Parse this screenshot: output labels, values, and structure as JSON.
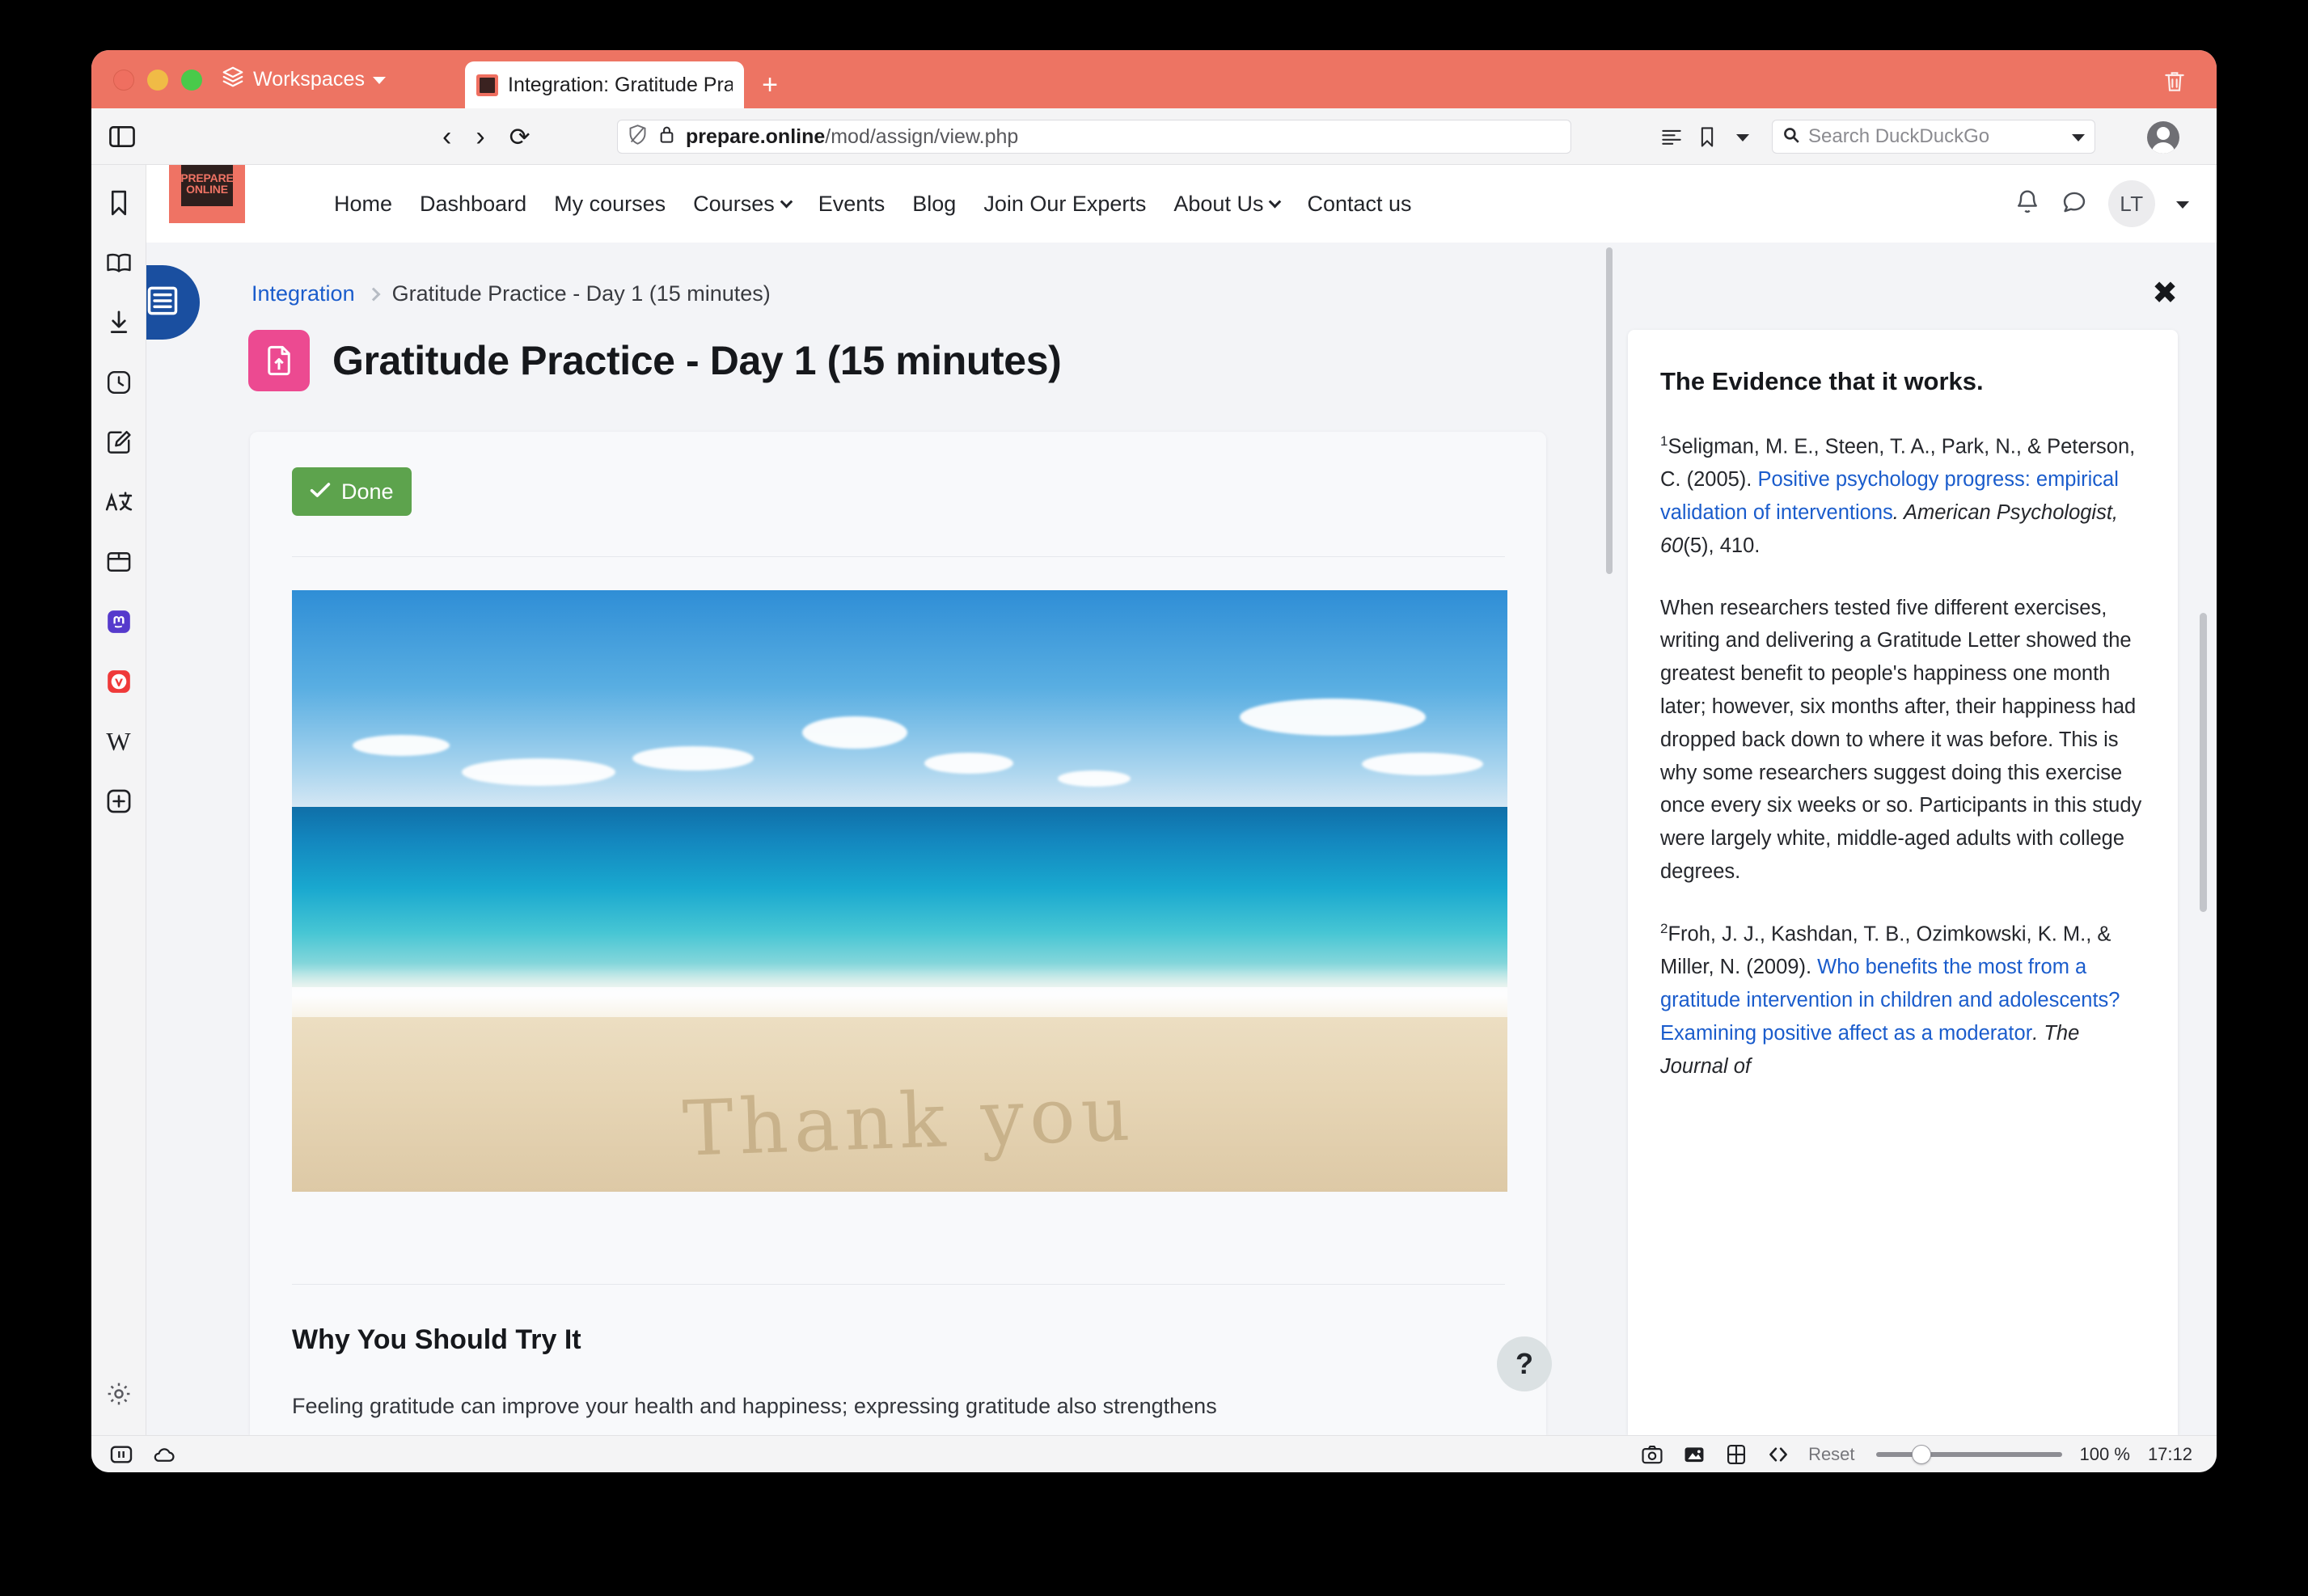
{
  "browser": {
    "workspaces_label": "Workspaces",
    "tab_title": "Integration: Gratitude Prac",
    "new_tab_label": "+",
    "url_host": "prepare.online",
    "url_path": "/mod/assign/view.php",
    "search_placeholder": "Search DuckDuckGo",
    "status": {
      "reset_label": "Reset",
      "zoom_value": "100 %",
      "clock": "17:12"
    }
  },
  "site": {
    "logo_line1": "PREPARE",
    "logo_line2": "ONLINE",
    "nav": [
      {
        "label": "Home",
        "has_caret": false
      },
      {
        "label": "Dashboard",
        "has_caret": false
      },
      {
        "label": "My courses",
        "has_caret": false
      },
      {
        "label": "Courses",
        "has_caret": true
      },
      {
        "label": "Events",
        "has_caret": false
      },
      {
        "label": "Blog",
        "has_caret": false
      },
      {
        "label": "Join Our Experts",
        "has_caret": false
      },
      {
        "label": "About Us",
        "has_caret": true
      },
      {
        "label": "Contact us",
        "has_caret": false
      }
    ],
    "user_initials": "LT"
  },
  "breadcrumb": {
    "parent": "Integration",
    "current": "Gratitude Practice - Day 1 (15 minutes)"
  },
  "page": {
    "title": "Gratitude Practice - Day 1 (15 minutes)",
    "done_badge": "Done",
    "image_alt_text": "Thank you",
    "section_heading": "Why You Should Try It",
    "section_body": "Feeling gratitude can improve your health and happiness; expressing gratitude also strengthens",
    "help_label": "?"
  },
  "evidence_panel": {
    "title": "The Evidence that it works.",
    "close_label": "✖",
    "citation_1": {
      "marker": "1",
      "authors_year": "Seligman, M. E., Steen, T. A., Park, N., & Peterson, C. (2005). ",
      "link_text": "Positive psychology progress: empirical validation of interventions",
      "journal_italic": ". American Psychologist, 60",
      "tail": "(5), 410."
    },
    "body_paragraph": "When researchers tested five different exercises, writing and delivering a Gratitude Letter showed the greatest benefit to people's happiness one month later; however, six months after, their happiness had dropped back down to where it was before. This is why some researchers suggest doing this exercise once every six weeks or so. Participants in this study were largely white, middle-aged adults with college degrees.",
    "citation_2": {
      "marker": "2",
      "authors_year": "Froh, J. J., Kashdan, T. B., Ozimkowski, K. M., & Miller, N. (2009). ",
      "link_text": "Who benefits the most from a gratitude intervention in children and adolescents? Examining positive affect as a moderator",
      "journal_italic": ". The Journal of"
    }
  },
  "colors": {
    "titlebar": "#ed7463",
    "brand_coral": "#ef7364",
    "done_green": "#5da34d",
    "assign_pink": "#ec4a91",
    "drawer_blue": "#1a4fa0",
    "link_blue": "#1a5ccc"
  }
}
